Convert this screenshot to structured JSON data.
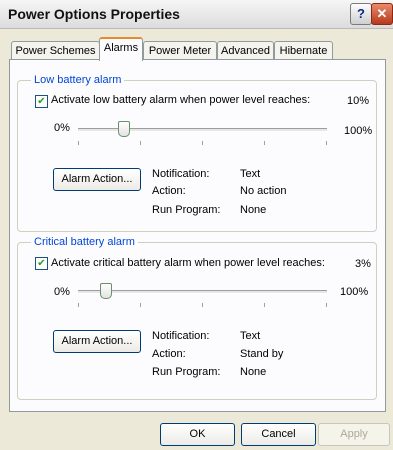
{
  "window": {
    "title": "Power Options Properties",
    "help_label": "?",
    "close_label": "✕"
  },
  "tabs": [
    {
      "label": "Power Schemes"
    },
    {
      "label": "Alarms",
      "active": true
    },
    {
      "label": "Power Meter"
    },
    {
      "label": "Advanced"
    },
    {
      "label": "Hibernate"
    }
  ],
  "low": {
    "title": "Low battery alarm",
    "checkbox_label": "Activate low battery alarm when power level reaches:",
    "checked": true,
    "value": "10%",
    "min": "0%",
    "max": "100%",
    "slider_level": 0.1,
    "button": "Alarm Action...",
    "notification_label": "Notification:",
    "notification_value": "Text",
    "action_label": "Action:",
    "action_value": "No action",
    "program_label": "Run Program:",
    "program_value": "None"
  },
  "critical": {
    "title": "Critical battery alarm",
    "checkbox_label": "Activate critical battery alarm when power level reaches:",
    "checked": true,
    "value": "3%",
    "min": "0%",
    "max": "100%",
    "slider_level": 0.03,
    "button": "Alarm Action...",
    "notification_label": "Notification:",
    "notification_value": "Text",
    "action_label": "Action:",
    "action_value": "Stand by",
    "program_label": "Run Program:",
    "program_value": "None"
  },
  "buttons": {
    "ok": "OK",
    "cancel": "Cancel",
    "apply": "Apply"
  }
}
